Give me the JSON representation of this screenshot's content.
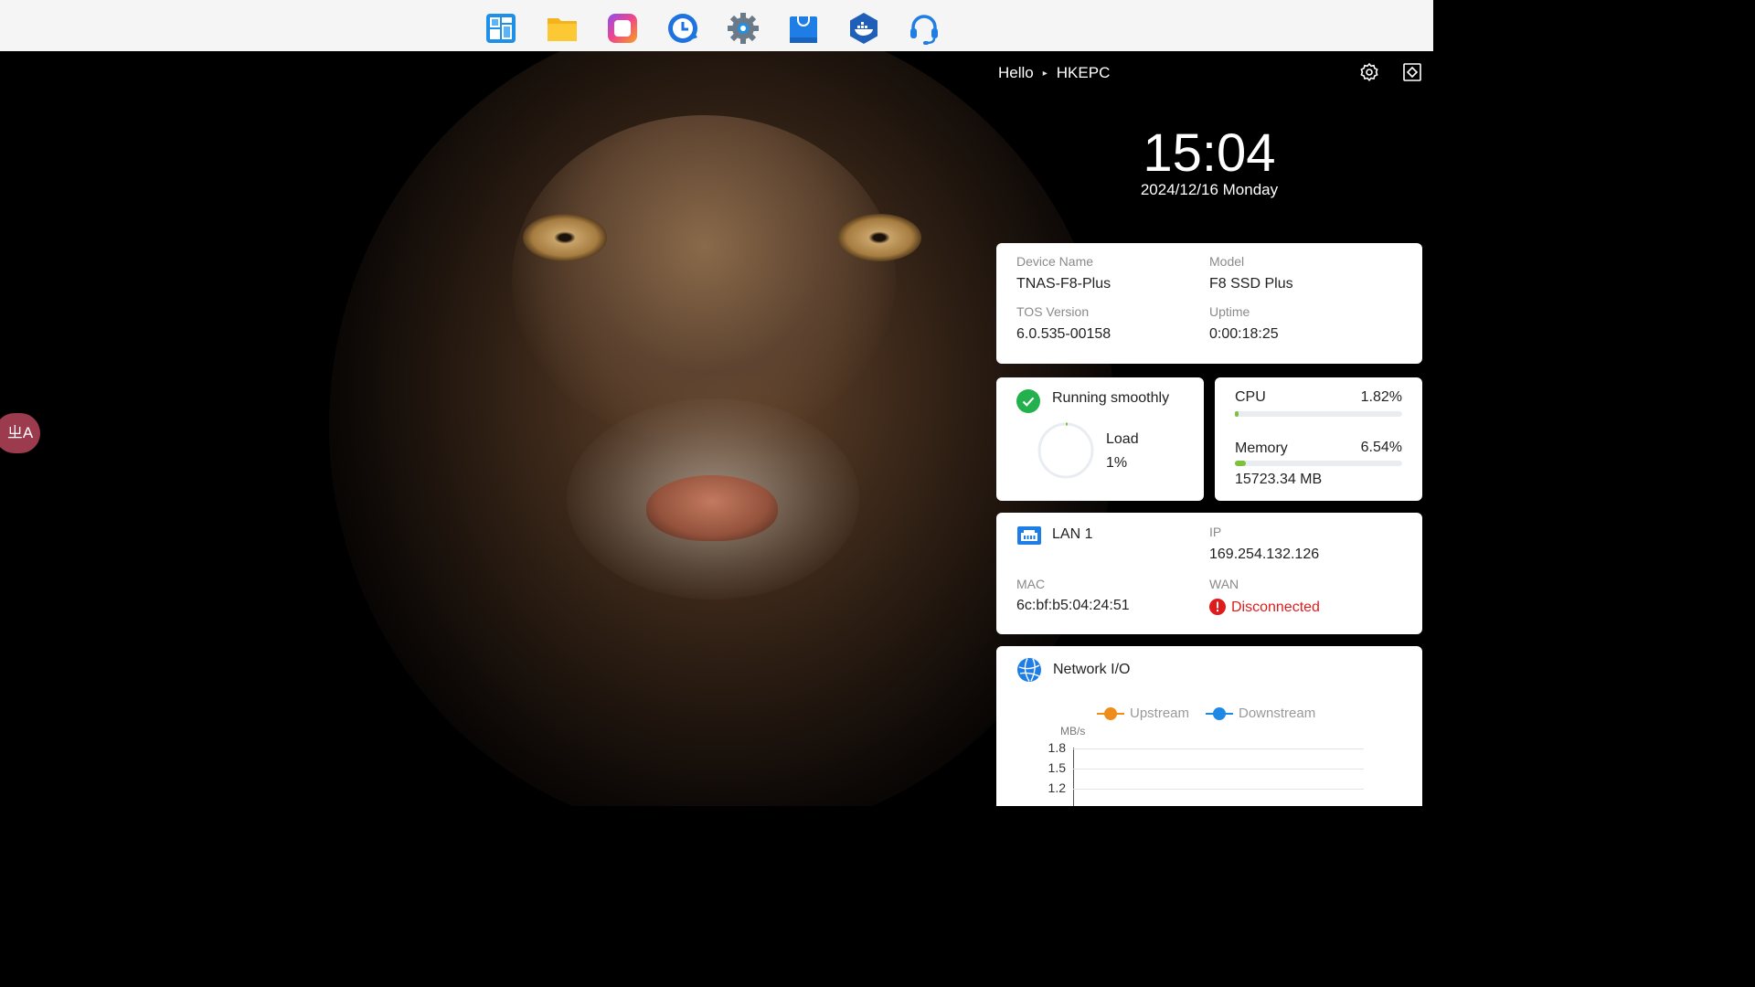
{
  "dock": {
    "icons": [
      {
        "name": "control-panel-icon"
      },
      {
        "name": "file-manager-icon"
      },
      {
        "name": "photos-app-icon"
      },
      {
        "name": "backup-app-icon"
      },
      {
        "name": "settings-gear-icon"
      },
      {
        "name": "app-center-icon"
      },
      {
        "name": "docker-icon"
      },
      {
        "name": "support-headset-icon"
      }
    ]
  },
  "header": {
    "greeting": "Hello",
    "username": "HKEPC"
  },
  "translate_button": {
    "label": "ㄓA"
  },
  "clock": {
    "time": "15:04",
    "date": "2024/12/16 Monday"
  },
  "device": {
    "name_label": "Device Name",
    "name_value": "TNAS-F8-Plus",
    "model_label": "Model",
    "model_value": "F8 SSD Plus",
    "tos_label": "TOS Version",
    "tos_value": "6.0.535-00158",
    "uptime_label": "Uptime",
    "uptime_value": "0:00:18:25"
  },
  "health": {
    "status": "Running smoothly",
    "load_label": "Load",
    "load_value": "1%",
    "load_fraction": 0.01
  },
  "resources": {
    "cpu_label": "CPU",
    "cpu_value": "1.82%",
    "cpu_fraction": 0.0182,
    "memory_label": "Memory",
    "memory_value": "6.54%",
    "memory_fraction": 0.0654,
    "memory_total": "15723.34 MB"
  },
  "network": {
    "lan_label": "LAN 1",
    "ip_label": "IP",
    "ip_value": "169.254.132.126",
    "mac_label": "MAC",
    "mac_value": "6c:bf:b5:04:24:51",
    "wan_label": "WAN",
    "wan_value": "Disconnected"
  },
  "network_io": {
    "title": "Network I/O",
    "unit": "MB/s",
    "legend": [
      "Upstream",
      "Downstream"
    ]
  },
  "chart_data": {
    "type": "line",
    "ylabel": "MB/s",
    "yticks": [
      "1.8",
      "1.5",
      "1.2"
    ],
    "series": [
      {
        "name": "Upstream",
        "values": []
      },
      {
        "name": "Downstream",
        "values": []
      }
    ]
  },
  "colors": {
    "accent_blue": "#1e88e5",
    "upstream": "#f08c1a",
    "downstream": "#1e88e5",
    "ok_green": "#22b14c",
    "bar_green": "#7cc23a",
    "error_red": "#e01b1b"
  }
}
